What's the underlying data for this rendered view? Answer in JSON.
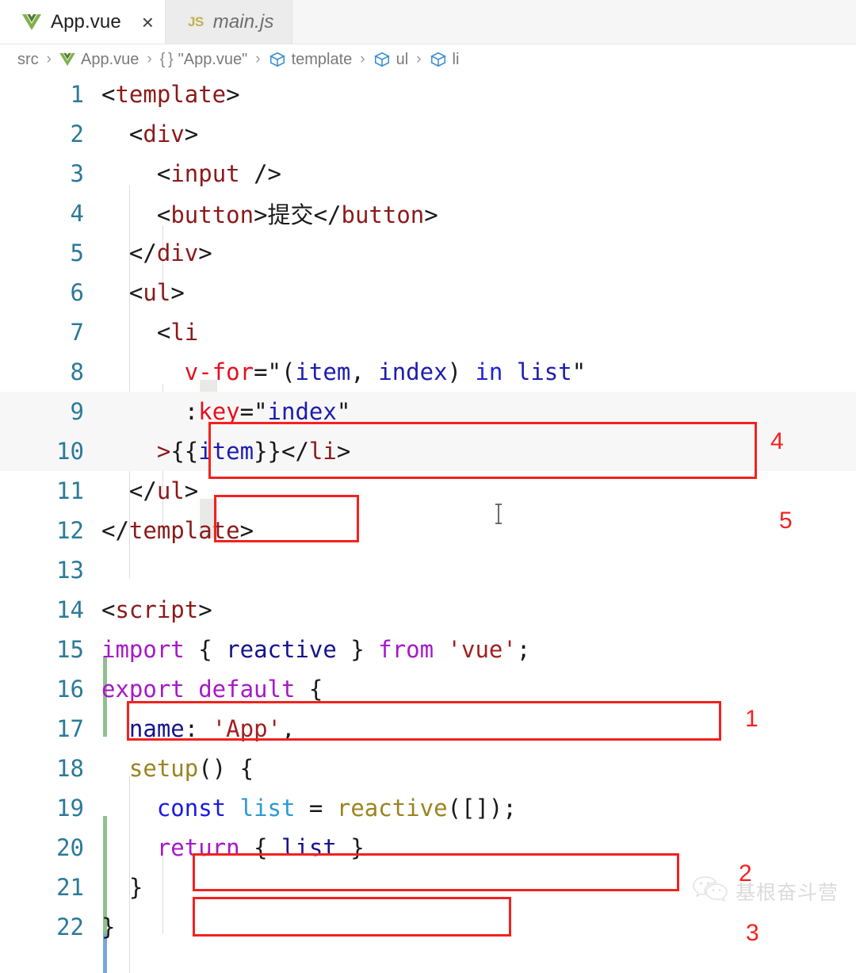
{
  "tabs": [
    {
      "label": "App.vue",
      "icon": "vue-icon",
      "active": true,
      "close_label": "×"
    },
    {
      "label": "main.js",
      "icon": "js-icon",
      "icon_text": "JS",
      "active": false
    }
  ],
  "breadcrumb": {
    "items": [
      {
        "label": "src",
        "icon": "none"
      },
      {
        "label": "App.vue",
        "icon": "vue-icon"
      },
      {
        "label": "\"App.vue\"",
        "icon": "braces-icon",
        "icon_text": "{ }"
      },
      {
        "label": "template",
        "icon": "cube-icon"
      },
      {
        "label": "ul",
        "icon": "cube-icon"
      },
      {
        "label": "li",
        "icon": "cube-icon"
      }
    ],
    "separator": "›"
  },
  "editor": {
    "lines": [
      {
        "no": "1",
        "text": "<template>"
      },
      {
        "no": "2",
        "text": "  <div>"
      },
      {
        "no": "3",
        "text": "    <input />"
      },
      {
        "no": "4",
        "text": "    <button>提交</button>"
      },
      {
        "no": "5",
        "text": "  </div>"
      },
      {
        "no": "6",
        "text": "  <ul>"
      },
      {
        "no": "7",
        "text": "    <li"
      },
      {
        "no": "8",
        "text": "      v-for=\"(item, index) in list\""
      },
      {
        "no": "9",
        "text": "      :key=\"index\""
      },
      {
        "no": "10",
        "text": "    >{{item}}</li>"
      },
      {
        "no": "11",
        "text": "  </ul>"
      },
      {
        "no": "12",
        "text": "</template>"
      },
      {
        "no": "13",
        "text": ""
      },
      {
        "no": "14",
        "text": "<script>"
      },
      {
        "no": "15",
        "text": "import { reactive } from 'vue';"
      },
      {
        "no": "16",
        "text": "export default {"
      },
      {
        "no": "17",
        "text": "  name: 'App',"
      },
      {
        "no": "18",
        "text": "  setup() {"
      },
      {
        "no": "19",
        "text": "    const list = reactive([]);"
      },
      {
        "no": "20",
        "text": "    return { list }"
      },
      {
        "no": "21",
        "text": "  }"
      },
      {
        "no": "22",
        "text": "}"
      }
    ]
  },
  "annotations": {
    "numbers": [
      {
        "label": "4"
      },
      {
        "label": "5"
      },
      {
        "label": "1"
      },
      {
        "label": "2"
      },
      {
        "label": "3"
      }
    ]
  },
  "watermark": {
    "text": "基根奋斗营",
    "icon": "wechat-icon"
  },
  "colors": {
    "annotation_red": "#f3221f",
    "tag": "#8b1a1a",
    "attribute": "#e60f1e",
    "value": "#1c1cb0",
    "keyword": "#a718c8",
    "string": "#a02020",
    "function": "#9b8320",
    "lineno": "#2b7a99"
  }
}
